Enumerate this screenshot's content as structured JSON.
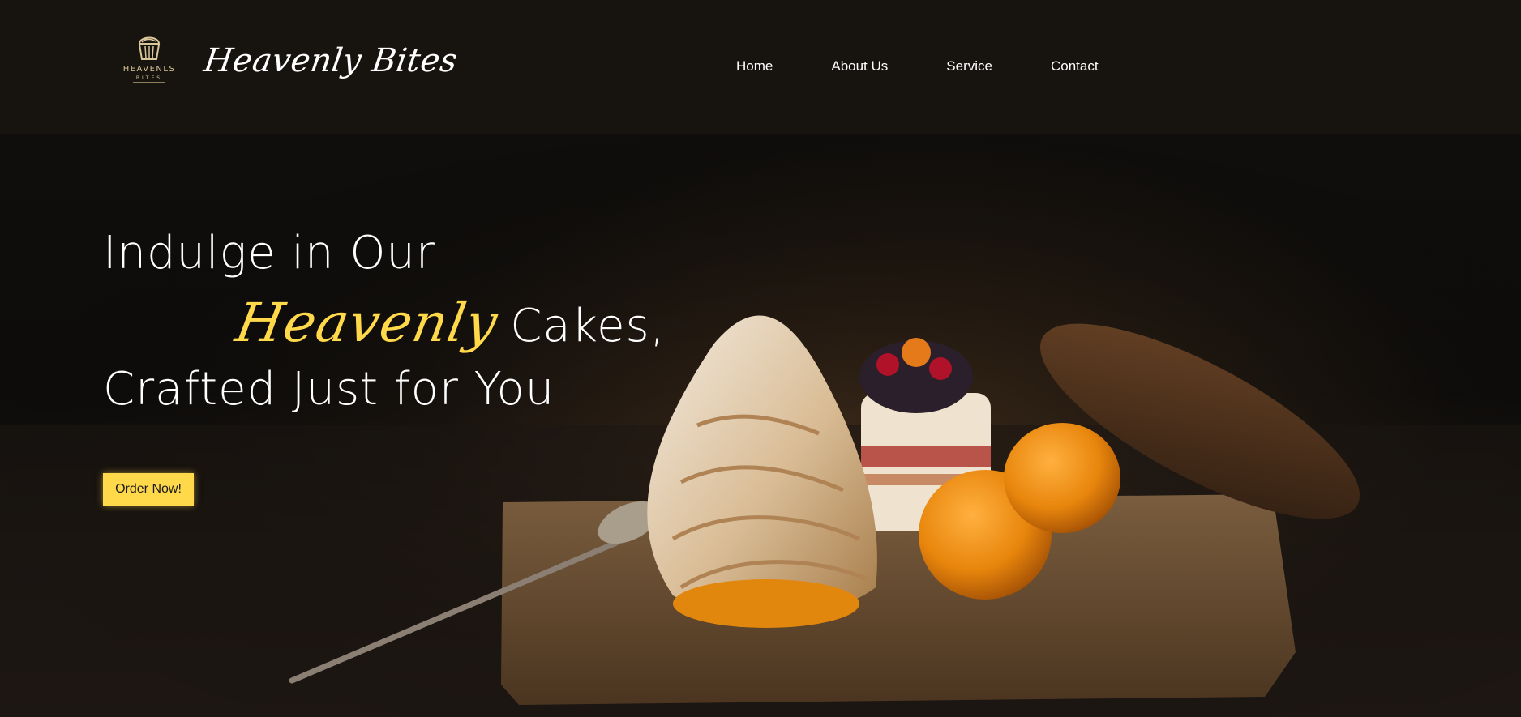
{
  "brand": {
    "logo_text": "HEAVENLS",
    "logo_sub": "BITES",
    "name": "Heavenly Bites"
  },
  "nav": {
    "items": [
      "Home",
      "About Us",
      "Service",
      "Contact"
    ]
  },
  "hero": {
    "line1": "Indulge in Our",
    "accent": "Heavenly",
    "line2_rest": "Cakes,",
    "line3": "Crafted Just for You",
    "cta_label": "Order Now!"
  },
  "colors": {
    "accent": "#ffd94a",
    "background": "#14110f",
    "text": "#ffffff"
  }
}
